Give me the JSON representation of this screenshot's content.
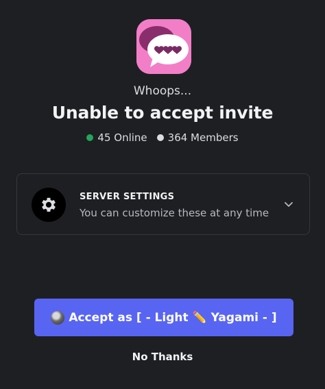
{
  "invite": {
    "subtitle": "Whoops...",
    "title": "Unable to accept invite",
    "online_count": "45 Online",
    "member_count": "364 Members"
  },
  "server_icon": {
    "icon": "chat-bubbles-hearts-icon",
    "background_color": "#f27ec8"
  },
  "settings": {
    "label": "SERVER SETTINGS",
    "description": "You can customize these at any time",
    "icon": "gear-icon",
    "expand_icon": "chevron-down-icon"
  },
  "actions": {
    "accept_label": "Accept as [ - Light ✏️ Yagami - ]",
    "decline_label": "No Thanks"
  },
  "colors": {
    "accent": "#5865f2",
    "online": "#23a55a",
    "background": "#1e1f22"
  }
}
